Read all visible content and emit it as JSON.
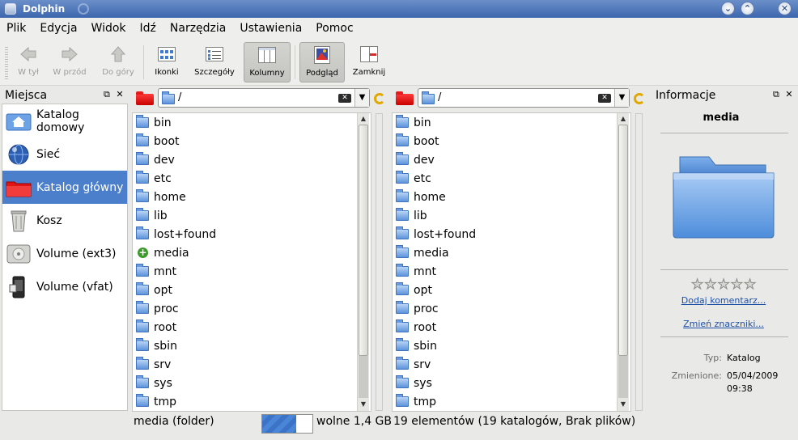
{
  "window": {
    "title": "Dolphin"
  },
  "menu": [
    "Plik",
    "Edycja",
    "Widok",
    "Idź",
    "Narzędzia",
    "Ustawienia",
    "Pomoc"
  ],
  "toolbar": {
    "back": "W tył",
    "forward": "W przód",
    "up": "Do góry",
    "icons": "Ikonki",
    "details": "Szczegóły",
    "columns": "Kolumny",
    "preview": "Podgląd",
    "close": "Zamknij"
  },
  "places": {
    "title": "Miejsca",
    "items": [
      {
        "label": "Katalog domowy",
        "icon": "home-icon"
      },
      {
        "label": "Sieć",
        "icon": "network-globe-icon"
      },
      {
        "label": "Katalog główny",
        "icon": "root-folder-icon",
        "selected": true
      },
      {
        "label": "Kosz",
        "icon": "trash-icon"
      },
      {
        "label": "Volume (ext3)",
        "icon": "hard-disk-icon"
      },
      {
        "label": "Volume (vfat)",
        "icon": "usb-drive-icon"
      }
    ]
  },
  "left_view": {
    "path": "/",
    "files": [
      "bin",
      "boot",
      "dev",
      "etc",
      "home",
      "lib",
      "lost+found",
      "media",
      "mnt",
      "opt",
      "proc",
      "root",
      "sbin",
      "srv",
      "sys",
      "tmp"
    ],
    "highlighted": "media",
    "status": "media (folder)",
    "free_space": "wolne 1,4 GB",
    "capacity_used": 0.68
  },
  "right_view": {
    "path": "/",
    "files": [
      "bin",
      "boot",
      "dev",
      "etc",
      "home",
      "lib",
      "lost+found",
      "media",
      "mnt",
      "opt",
      "proc",
      "root",
      "sbin",
      "srv",
      "sys",
      "tmp"
    ],
    "status": "19 elementów (19 katalogów, Brak plików)"
  },
  "info": {
    "title": "Informacje",
    "name": "media",
    "rating": 0,
    "rating_max": 5,
    "add_comment": "Dodaj komentarz...",
    "change_tags": "Zmień znaczniki...",
    "type_label": "Typ:",
    "type_value": "Katalog",
    "modified_label": "Zmienione:",
    "modified_date": "05/04/2009",
    "modified_time": "09:38"
  },
  "colors": {
    "selection": "#4b7fcc",
    "titlebar": "#3c66ad",
    "link": "#1c50a8"
  }
}
